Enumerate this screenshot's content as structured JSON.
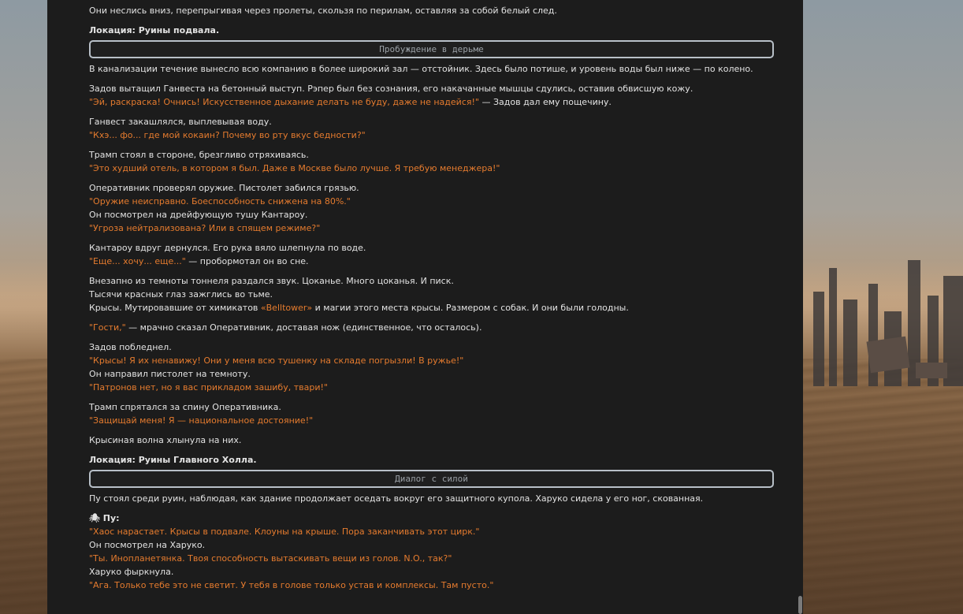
{
  "lines": [
    {
      "t": "Они неслись вниз, перепрыгивая через пролеты, скользя по перилам, оставляя за собой белый след."
    },
    {
      "t": "Локация: Руины подвала."
    },
    {
      "t": "Пробуждение в дерьме"
    },
    {
      "t": "В канализации течение вынесло всю компанию в более широкий зал — отстойник. Здесь было потише, и уровень воды был ниже — по колено."
    },
    {
      "t": "Задов вытащил Ганвеста на бетонный выступ. Рэпер был без сознания, его накачанные мышцы сдулись, оставив обвисшую кожу."
    },
    {
      "q": "\"Эй, раскраска! Очнись! Искусственное дыхание делать не буду, даже не надейся!\"",
      "t": " — Задов дал ему пощечину."
    },
    {
      "t": "Ганвест закашлялся, выплевывая воду."
    },
    {
      "q": "\"Кхэ... фо... где мой кокаин? Почему во рту вкус бедности?\""
    },
    {
      "t": "Трамп стоял в стороне, брезгливо отряхиваясь."
    },
    {
      "q": "\"Это худший отель, в котором я был. Даже в Москве было лучше. Я требую менеджера!\""
    },
    {
      "t": "Оперативник проверял оружие. Пистолет забился грязью."
    },
    {
      "q": "\"Оружие неисправно. Боеспособность снижена на 80%.\""
    },
    {
      "t": "Он посмотрел на дрейфующую тушу Кантароу."
    },
    {
      "q": "\"Угроза нейтрализована? Или в спящем режиме?\""
    },
    {
      "t": "Кантароу вдруг дернулся. Его рука вяло шлепнула по воде."
    },
    {
      "q": "\"Еще... хочу... еще...\"",
      "t": " — пробормотал он во сне."
    },
    {
      "t": "Внезапно из темноты тоннеля раздался звук. Цоканье. Много цоканья. И писк."
    },
    {
      "t": "Тысячи красных глаз зажглись во тьме."
    },
    {
      "t1": "Крысы. Мутировавшие от химикатов ",
      "q": "«Belltower»",
      "t2": " и магии этого места крысы. Размером с собак. И они были голодны."
    },
    {
      "q": "\"Гости,\"",
      "t": " — мрачно сказал Оперативник, доставая нож (единственное, что осталось)."
    },
    {
      "t": "Задов побледнел."
    },
    {
      "q": "\"Крысы! Я их ненавижу! Они у меня всю тушенку на складе погрызли! В ружье!\""
    },
    {
      "t": "Он направил пистолет на темноту."
    },
    {
      "q": "\"Патронов нет, но я вас прикладом зашибу, твари!\""
    },
    {
      "t": "Трамп спрятался за спину Оперативника."
    },
    {
      "q": "\"Защищай меня! Я — национальное достояние!\""
    },
    {
      "t": "Крысиная волна хлынула на них."
    },
    {
      "t": "Локация: Руины Главного Холла."
    },
    {
      "t": "Диалог с силой"
    },
    {
      "t": "Пу стоял среди руин, наблюдая, как здание продолжает оседать вокруг его защитного купола. Харуко сидела у его ног, скованная."
    },
    {
      "icon": "🕷",
      "t": " Пу:"
    },
    {
      "q": "\"Хаос нарастает. Крысы в подвале. Клоуны на крыше. Пора заканчивать этот цирк.\""
    },
    {
      "t": "Он посмотрел на Харуко."
    },
    {
      "q": "\"Ты. Инопланетянка. Твоя способность вытаскивать вещи из голов. N.O., так?\""
    },
    {
      "t": "Харуко фыркнула."
    },
    {
      "q": "\"Ага. Только тебе это не светит. У тебя в голове только устав и комплексы. Там пусто.\""
    }
  ],
  "colors": {
    "quote": "#e57b2e",
    "panel": "#1c1c1c",
    "text": "#e3e3e3"
  }
}
